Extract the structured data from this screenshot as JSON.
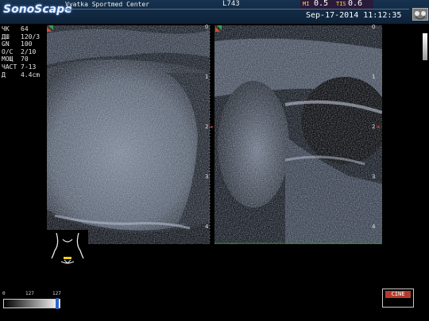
{
  "header": {
    "brand": "SonoScape",
    "brand_sub": "",
    "institution": "Vyatka Sportmed Center",
    "probe": "L743",
    "mi_label": "MI",
    "mi_value": "0.5",
    "tis_label": "TIS",
    "tis_value": "0.6",
    "datetime": "Sep-17-2014 11:12:35"
  },
  "params": [
    {
      "key": "ЧК",
      "value": "64"
    },
    {
      "key": "ДШ",
      "value": "120/3"
    },
    {
      "key": "GN",
      "value": "100"
    },
    {
      "key": "O/C",
      "value": "2/10"
    },
    {
      "key": "МОЩ",
      "value": "70"
    },
    {
      "key": "ЧАСТ",
      "value": "7-13"
    },
    {
      "key": "Д",
      "value": "4.4cm"
    }
  ],
  "depth_left": [
    "0",
    "1",
    "2",
    "3",
    "4"
  ],
  "depth_right": [
    "0",
    "1",
    "2",
    "3",
    "4"
  ],
  "graybar": {
    "min": "0",
    "mid": "127",
    "max": "127"
  },
  "cine": {
    "label": "CINE"
  },
  "colors": {
    "header_bg": "#16324f",
    "mi_bg": "#2a1b3a",
    "focus_marker": "#d23a3a",
    "cine": "#b23a2d"
  },
  "icons": [
    "freeze-icon",
    "orientation-marker-icon",
    "body-mark-icon",
    "focus-marker-icon"
  ]
}
